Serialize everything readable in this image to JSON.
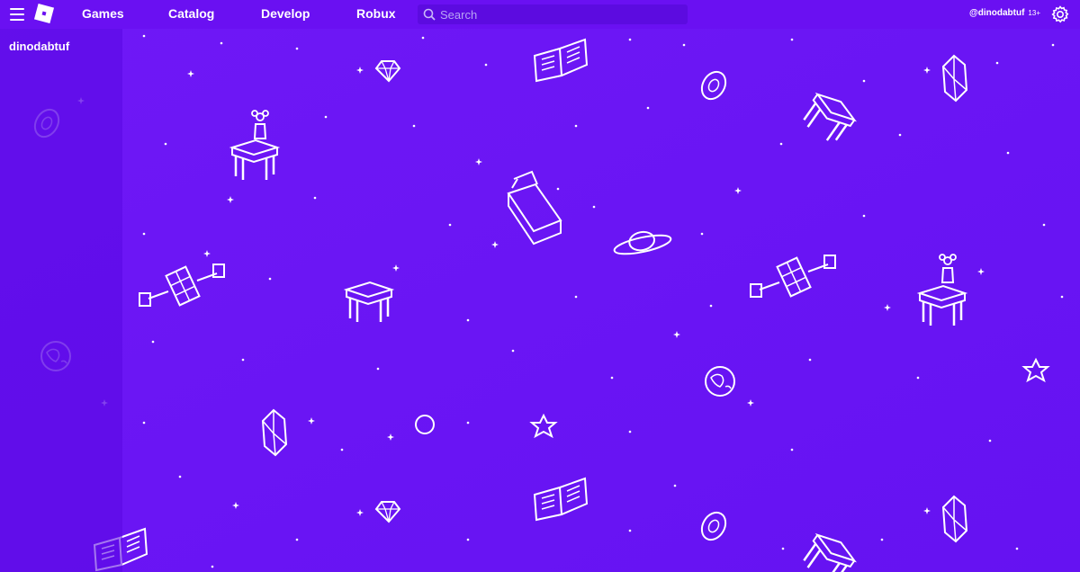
{
  "topbar": {
    "nav": [
      "Games",
      "Catalog",
      "Develop",
      "Robux"
    ],
    "search_placeholder": "Search",
    "username": "@dinodabtuf",
    "age_badge": "13+"
  },
  "sidebar": {
    "username": "dinodabtuf"
  },
  "icons": {
    "menu": "hamburger-menu-icon",
    "logo": "roblox-logo-icon",
    "search": "search-icon",
    "settings": "gear-icon"
  },
  "colors": {
    "background": "#6a14f5",
    "topbar": "#6a10f2",
    "sidebar": "#5a08e1",
    "text": "#ffffff"
  }
}
